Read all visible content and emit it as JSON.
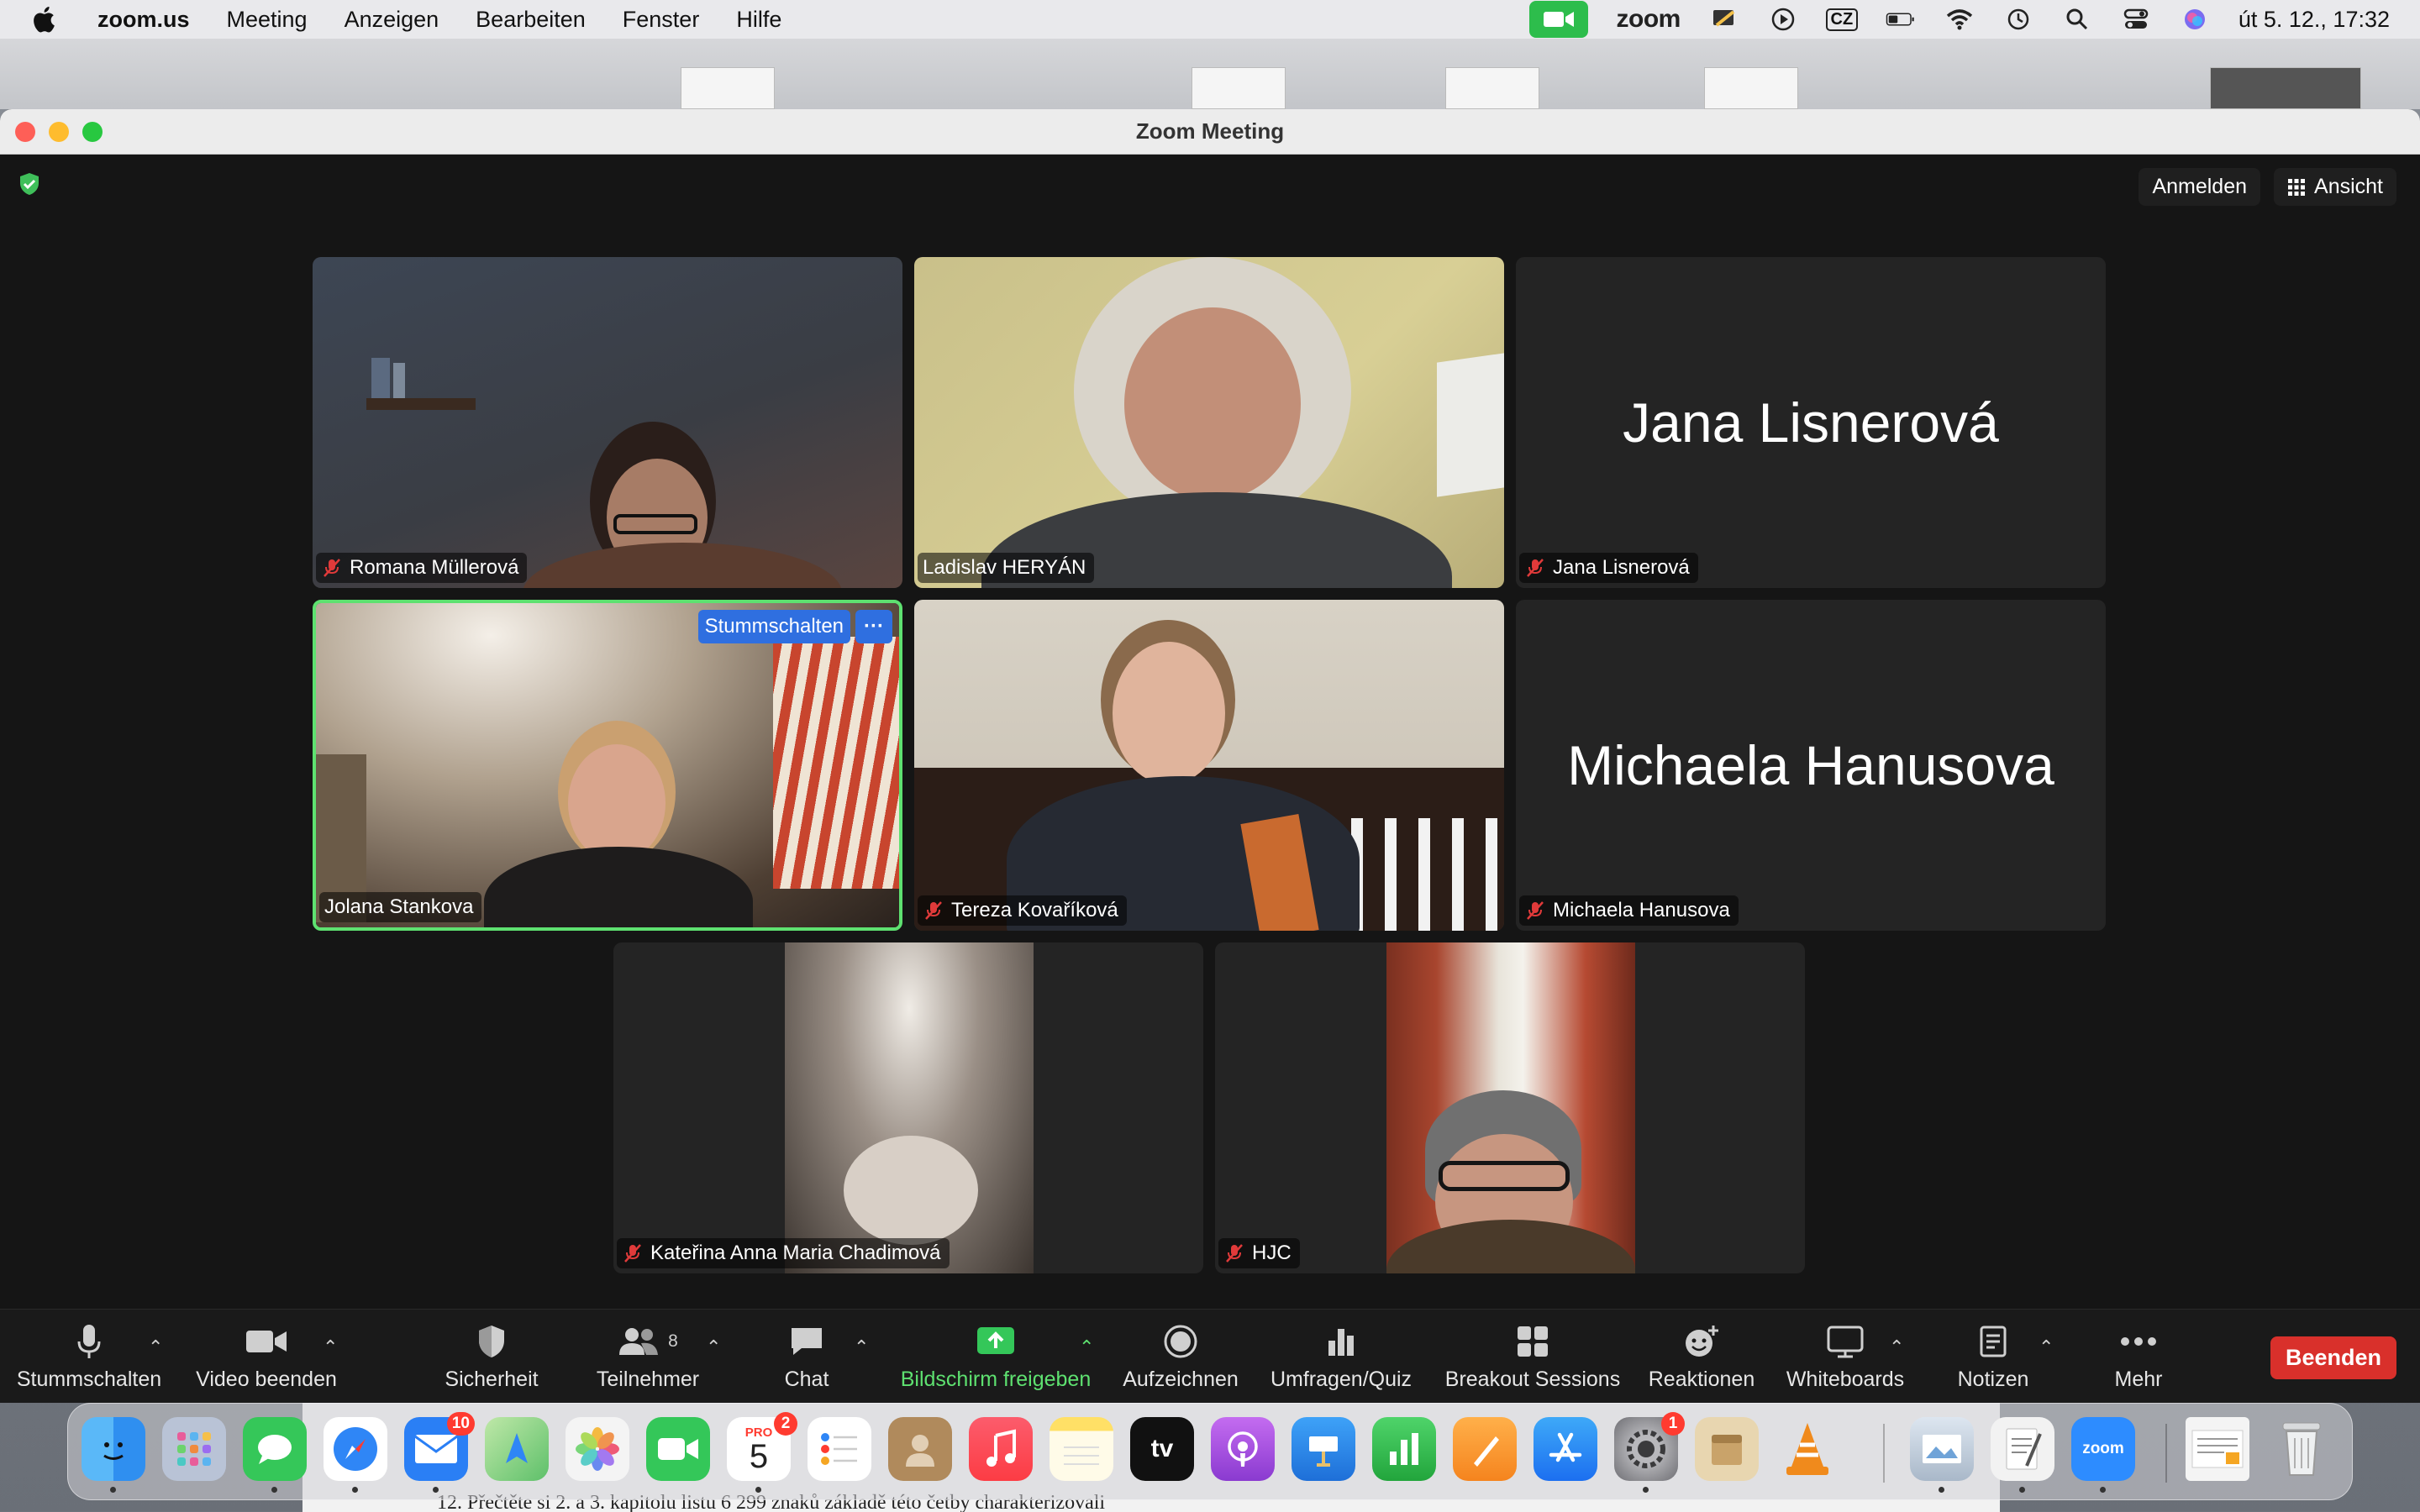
{
  "menubar": {
    "app_name": "zoom.us",
    "menus": [
      "Meeting",
      "Anzeigen",
      "Bearbeiten",
      "Fenster",
      "Hilfe"
    ],
    "zoom_status_label": "zoom",
    "keyboard_layout": "CZ",
    "clock": "út 5. 12., 17:32"
  },
  "window": {
    "title": "Zoom Meeting",
    "sign_in_label": "Anmelden",
    "view_label": "Ansicht"
  },
  "participants": [
    {
      "name": "Romana Müllerová",
      "muted": true,
      "video": true
    },
    {
      "name": "Ladislav HERYÁN",
      "muted": false,
      "video": true
    },
    {
      "name": "Jana Lisnerová",
      "muted": true,
      "video": false
    },
    {
      "name": "Jolana Stankova",
      "muted": false,
      "video": true,
      "active_speaker": true
    },
    {
      "name": "Tereza Kovaříková",
      "muted": true,
      "video": true
    },
    {
      "name": "Michaela Hanusova",
      "muted": true,
      "video": false
    },
    {
      "name": "Kateřina Anna Maria Chadimová",
      "muted": true,
      "video": true
    },
    {
      "name": "HJC",
      "muted": true,
      "video": true
    }
  ],
  "tile_controls": {
    "mute_label": "Stummschalten",
    "more_label": "···"
  },
  "toolbar": {
    "mute_label": "Stummschalten",
    "video_label": "Video beenden",
    "security_label": "Sicherheit",
    "participants_label": "Teilnehmer",
    "participants_count": "8",
    "chat_label": "Chat",
    "share_label": "Bildschirm freigeben",
    "record_label": "Aufzeichnen",
    "polls_label": "Umfragen/Quiz",
    "breakout_label": "Breakout Sessions",
    "reactions_label": "Reaktionen",
    "whiteboards_label": "Whiteboards",
    "notes_label": "Notizen",
    "more_label": "Mehr",
    "end_label": "Beenden",
    "accent_green": "#5ee170",
    "end_color": "#d9302b"
  },
  "dock": {
    "apps": [
      {
        "name": "Finder",
        "color": "#2f8ff0"
      },
      {
        "name": "Launchpad",
        "color": "#b9c3d6"
      },
      {
        "name": "Messages",
        "color": "#35c759"
      },
      {
        "name": "Safari",
        "color": "#2f86f6"
      },
      {
        "name": "Mail",
        "color": "#2a7ff5",
        "badge": "10"
      },
      {
        "name": "Maps",
        "color": "#5ec06a"
      },
      {
        "name": "Photos",
        "color": "#f4f4f4"
      },
      {
        "name": "FaceTime",
        "color": "#34c759"
      },
      {
        "name": "Calendar",
        "color": "#ffffff",
        "badge": "2",
        "month": "PRO",
        "day": "5"
      },
      {
        "name": "Reminders",
        "color": "#ffffff"
      },
      {
        "name": "Contacts",
        "color": "#b08a5c"
      },
      {
        "name": "Music",
        "color": "#fc3c44"
      },
      {
        "name": "Notes",
        "color": "#ffe066"
      },
      {
        "name": "TV",
        "color": "#111111",
        "label": "tv"
      },
      {
        "name": "Podcasts",
        "color": "#9b44e0"
      },
      {
        "name": "Keynote",
        "color": "#1e8cf0"
      },
      {
        "name": "Numbers",
        "color": "#2fbf4a"
      },
      {
        "name": "Pages",
        "color": "#f59b1e"
      },
      {
        "name": "App Store",
        "color": "#1c8cf6"
      },
      {
        "name": "System Settings",
        "color": "#8e8e93",
        "badge": "1"
      },
      {
        "name": "Archive Utility",
        "color": "#e8d6b0"
      },
      {
        "name": "VLC",
        "color": "#f08a1c"
      },
      {
        "name": "Preview",
        "color": "#dde6f0"
      },
      {
        "name": "TextEdit",
        "color": "#f2f2f2"
      },
      {
        "name": "Zoom",
        "color": "#2d8cff",
        "label": "zoom"
      },
      {
        "name": "Document",
        "color": "#f4f4f4"
      },
      {
        "name": "Trash",
        "color": "#d8dadc"
      }
    ]
  },
  "background_document": {
    "line_text": "12. Přečtěte si 2. a 3. kapitolu listu      6 299 znaků      základě této četby charakterizovali"
  }
}
